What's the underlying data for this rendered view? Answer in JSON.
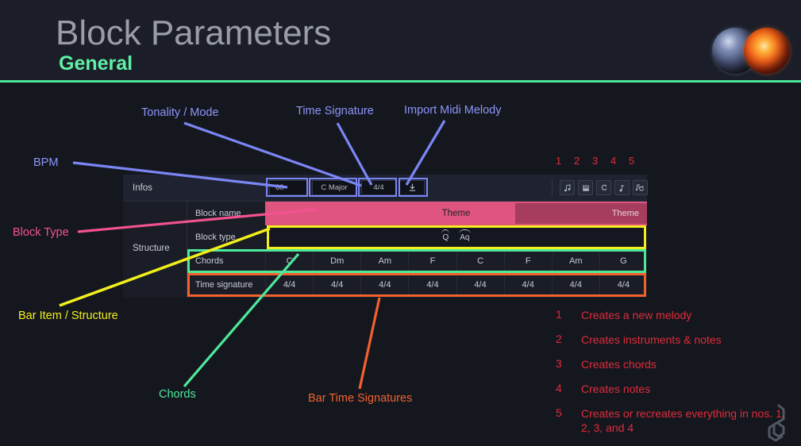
{
  "header": {
    "title": "Block Parameters",
    "subtitle": "General",
    "accent_color": "#4ee89b",
    "title_color": "#9a9da6",
    "logo_left_icon": "blue-sphere-icon",
    "logo_right_icon": "orange-sphere-icon"
  },
  "panel": {
    "section_labels": {
      "infos": "Infos",
      "structure": "Structure"
    },
    "controls": {
      "bpm": {
        "value": "60",
        "placeholder": "BPM"
      },
      "tonality": {
        "value": "C Major"
      },
      "time_signature": {
        "value": "4/4"
      },
      "import": {
        "icon": "import-midi-icon",
        "label": ""
      }
    },
    "action_icons": [
      {
        "number": "1",
        "icon": "melody-note-icon"
      },
      {
        "number": "2",
        "icon": "piano-keys-icon"
      },
      {
        "number": "3",
        "icon": "chord-icon"
      },
      {
        "number": "4",
        "icon": "single-note-icon"
      },
      {
        "number": "5",
        "icon": "regenerate-all-icon"
      }
    ],
    "rows": {
      "block_name": {
        "label": "Block name",
        "center_value": "Theme",
        "segment_value": "Theme",
        "color": "#e0557f"
      },
      "block_type": {
        "label": "Block type",
        "chips": [
          "Q",
          "Aq"
        ]
      },
      "chords": {
        "label": "Chords",
        "values": [
          "C",
          "Dm",
          "Am",
          "F",
          "C",
          "F",
          "Am",
          "G"
        ]
      },
      "time_signature": {
        "label": "Time signature",
        "values": [
          "4/4",
          "4/4",
          "4/4",
          "4/4",
          "4/4",
          "4/4",
          "4/4",
          "4/4"
        ]
      }
    }
  },
  "annotations": {
    "bpm": "BPM",
    "tonality_mode": "Tonality / Mode",
    "time_signature": "Time Signature",
    "import_midi": "Import Midi Melody",
    "block_type": "Block Type",
    "bar_item_structure": "Bar Item / Structure",
    "chords": "Chords",
    "bar_time_signatures": "Bar Time Signatures"
  },
  "legend": {
    "items": [
      {
        "number": "1",
        "text": "Creates a new melody"
      },
      {
        "number": "2",
        "text": "Creates instruments & notes"
      },
      {
        "number": "3",
        "text": "Creates chords"
      },
      {
        "number": "4",
        "text": "Creates notes"
      },
      {
        "number": "5",
        "text": "Creates or recreates everything in nos. 1, 2, 3, and 4"
      }
    ],
    "color": "#e02b3a"
  },
  "watermark": {
    "icon": "treble-clef-logo-icon"
  }
}
